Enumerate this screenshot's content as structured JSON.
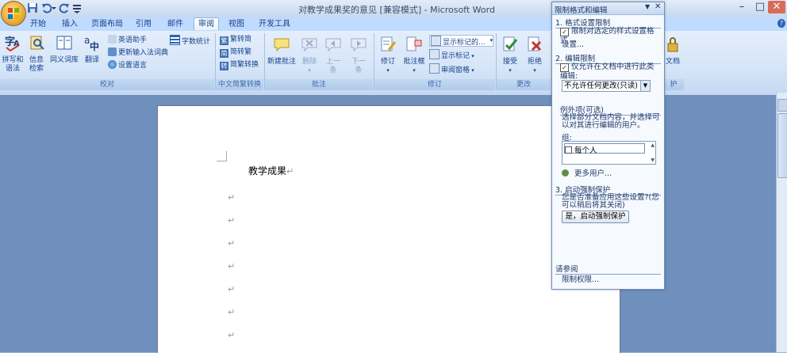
{
  "window": {
    "title": "对教学成果奖的意见 [兼容模式] - Microsoft Word",
    "controls": {
      "minimize": "–",
      "restore": "□",
      "close": "✕"
    },
    "help": "?"
  },
  "tabs": [
    "开始",
    "插入",
    "页面布局",
    "引用",
    "邮件",
    "审阅",
    "视图",
    "开发工具"
  ],
  "active_tab": "审阅",
  "ribbon": {
    "proofing": {
      "label": "校对",
      "spell": "拼写和\n语法",
      "research": "信息\n检索",
      "thesaurus": "同义词库",
      "translate": "翻译",
      "translate_tip": "英语助手",
      "update_ime": "更新输入法词典",
      "set_language": "设置语言",
      "word_count": "字数统计"
    },
    "chinese": {
      "label": "中文简繁转换",
      "to_simplified": "繁转简",
      "to_traditional": "简转繁",
      "convert": "简繁转换"
    },
    "comments": {
      "label": "批注",
      "new": "新建批注",
      "delete": "删除",
      "prev": "上一\n条",
      "next": "下一\n条"
    },
    "tracking": {
      "label": "修订",
      "track": "修订",
      "balloons": "批注框",
      "display_markup": "显示标记的...",
      "show_markup": "显示标记",
      "review_pane": "审阅窗格"
    },
    "changes": {
      "label": "更改",
      "accept": "接受",
      "reject": "拒绝"
    },
    "protect": {
      "label": "护",
      "protect_doc": "文档"
    }
  },
  "document": {
    "heading": "教学成果",
    "para_mark": "↵"
  },
  "pane": {
    "title": "限制格式和编辑",
    "section1": "1. 格式设置限制",
    "section1_check": "限制对选定的样式设置格式",
    "section1_link": "设置...",
    "section2": "2. 编辑限制",
    "section2_check": "仅允许在文档中进行此类编辑:",
    "edit_type": "不允许任何更改(只读)",
    "exceptions_title": "例外项(可选)",
    "exceptions_desc": "选择部分文档内容，并选择可以对其进行编辑的用户。",
    "groups_label": "组:",
    "group_item": "每个人",
    "more_users": "更多用户...",
    "section3": "3. 启动强制保护",
    "section3_desc": "您是否准备应用这些设置?(您可以稍后将其关闭)",
    "start_button": "是，启动强制保护",
    "see_also": "请参阅",
    "permissions_link": "限制权限..."
  }
}
